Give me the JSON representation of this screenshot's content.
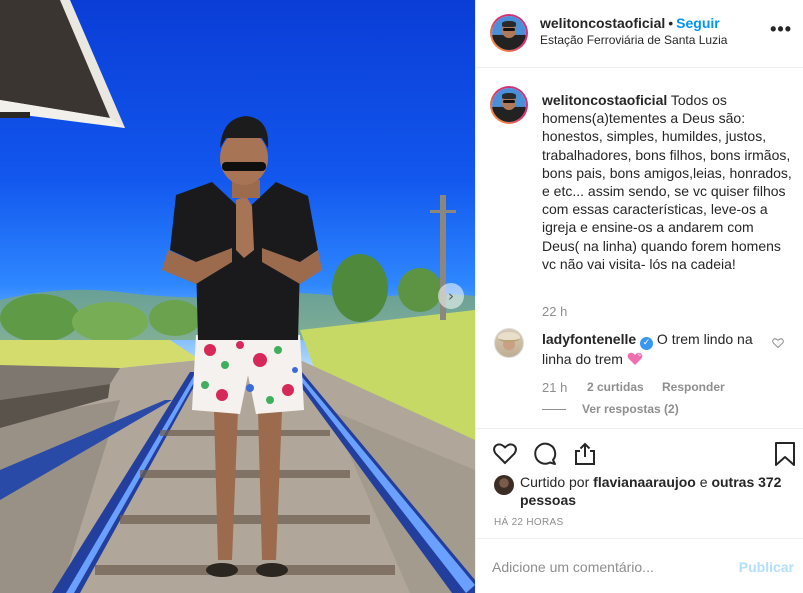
{
  "post": {
    "author": "welitoncostaoficial",
    "separator": "•",
    "follow_label": "Seguir",
    "location": "Estação Ferroviária de Santa Luzia",
    "more_icon": "more-options-icon",
    "more_label": "•••"
  },
  "caption": {
    "author": "welitoncostaoficial",
    "text": "Todos os homens(a)tementes a Deus são: honestos, simples, humildes, justos, trabalhadores, bons filhos, bons irmãos, bons pais, bons amigos,leias, honrados, e etc... assim sendo, se vc quiser filhos com essas características, leve-os a igreja e ensine-os a andarem com Deus( na linha) quando forem homens vc não vai visita- lós na cadeia!",
    "time": "22 h"
  },
  "comment": {
    "author": "ladyfontenelle",
    "text": "O trem lindo na linha do trem",
    "time": "21 h",
    "likes": "2 curtidas",
    "reply_label": "Responder",
    "view_replies": "Ver respostas (2)"
  },
  "actions": {
    "icons": [
      "heart-icon",
      "comment-icon",
      "share-icon",
      "bookmark-icon"
    ]
  },
  "likes": {
    "prefix": "Curtido por ",
    "user": "flavianaaraujoo",
    "middle": " e ",
    "others": "outras 372 pessoas"
  },
  "timestamp": "HÁ 22 HORAS",
  "comment_box": {
    "placeholder": "Adicione um comentário...",
    "publish_label": "Publicar"
  },
  "colors": {
    "link": "#0095f6",
    "publish_disabled": "#b2dffc",
    "muted": "#8e8e8e",
    "text": "#262626"
  }
}
